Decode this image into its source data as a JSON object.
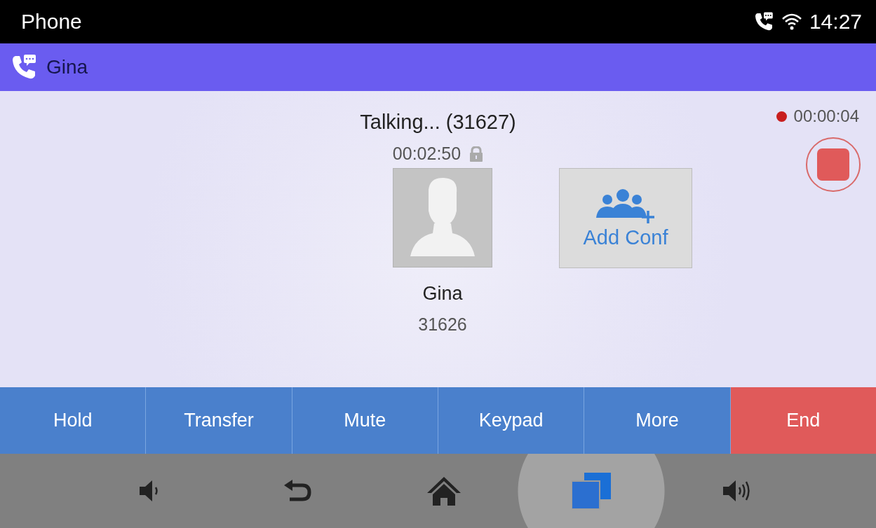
{
  "status_bar": {
    "title": "Phone",
    "time": "14:27"
  },
  "header": {
    "contact": "Gina"
  },
  "call": {
    "status": "Talking... (31627)",
    "duration": "00:02:50",
    "encrypted": true,
    "contact_name": "Gina",
    "contact_number": "31626",
    "add_conf": {
      "label": "Add Conf"
    },
    "recording": {
      "on": true,
      "elapsed": "00:00:04"
    }
  },
  "actions": [
    {
      "label": "Hold",
      "kind": "normal"
    },
    {
      "label": "Transfer",
      "kind": "normal"
    },
    {
      "label": "Mute",
      "kind": "normal"
    },
    {
      "label": "Keypad",
      "kind": "normal"
    },
    {
      "label": "More",
      "kind": "normal"
    },
    {
      "label": "End",
      "kind": "danger"
    }
  ],
  "nav": [
    {
      "kind": "volume-down",
      "selected": false
    },
    {
      "kind": "back",
      "selected": false
    },
    {
      "kind": "home",
      "selected": false
    },
    {
      "kind": "recents",
      "selected": true
    },
    {
      "kind": "volume-up",
      "selected": false
    }
  ]
}
